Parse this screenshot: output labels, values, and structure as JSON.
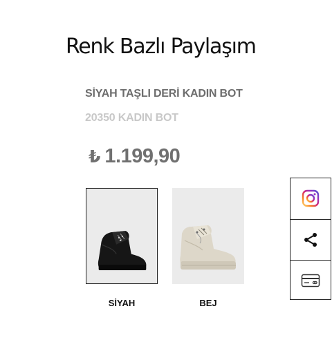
{
  "header": {
    "title": "Renk Bazlı Paylaşım"
  },
  "product": {
    "name": "SİYAH TAŞLI DERİ KADIN BOT",
    "code": "20350 KADIN BOT",
    "currency_symbol": "₺",
    "price": "1.199,90"
  },
  "colors": [
    {
      "label": "SİYAH",
      "selected": true,
      "image": "black-boot"
    },
    {
      "label": "BEJ",
      "selected": false,
      "image": "beige-boot"
    }
  ],
  "share": {
    "buttons": [
      {
        "icon": "instagram-icon"
      },
      {
        "icon": "share-icon"
      },
      {
        "icon": "card-icon"
      }
    ],
    "instagram_colors": [
      "#feda75",
      "#fa7e1e",
      "#d62976",
      "#962fbf",
      "#4f5bd5"
    ]
  }
}
